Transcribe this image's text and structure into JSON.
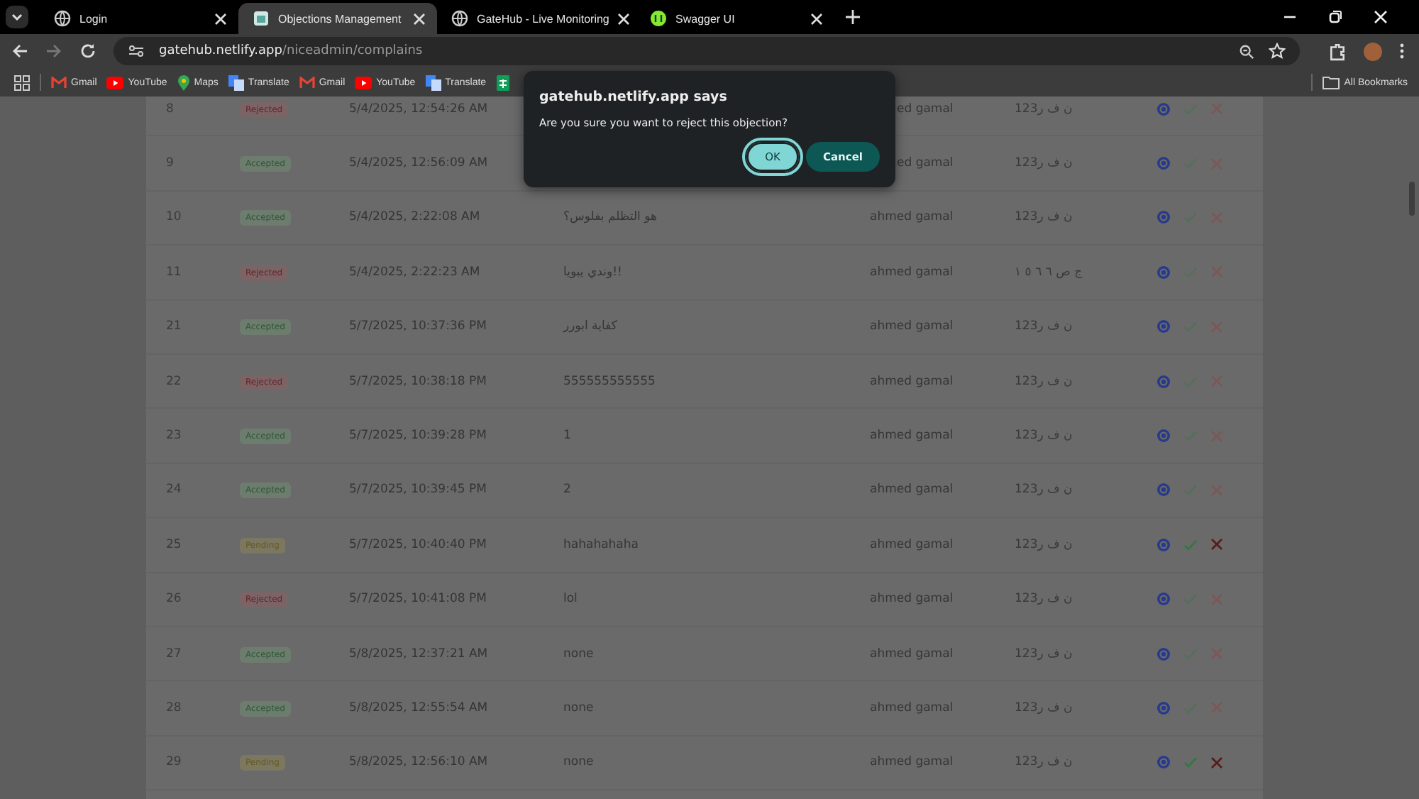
{
  "browser": {
    "tabs": [
      {
        "title": "Login",
        "kind": "globe",
        "selected": false
      },
      {
        "title": "Objections Management",
        "kind": "app",
        "selected": true
      },
      {
        "title": "GateHub - Live Monitoring",
        "kind": "globe",
        "selected": false
      },
      {
        "title": "Swagger UI",
        "kind": "swagger",
        "selected": false
      }
    ],
    "url_host": "gatehub.netlify.app",
    "url_path": "/niceadmin/complains",
    "bookmarks": [
      {
        "label": "Gmail",
        "kind": "gmail"
      },
      {
        "label": "YouTube",
        "kind": "youtube"
      },
      {
        "label": "Maps",
        "kind": "maps"
      },
      {
        "label": "Translate",
        "kind": "translate"
      },
      {
        "label": "Gmail",
        "kind": "gmail"
      },
      {
        "label": "YouTube",
        "kind": "youtube"
      },
      {
        "label": "Translate",
        "kind": "translate"
      },
      {
        "kind": "sheets"
      }
    ],
    "all_bookmarks": "All Bookmarks"
  },
  "table": {
    "rows": [
      {
        "id": "8",
        "status": "Rejected",
        "kind": "rejected",
        "date": "5/4/2025, 12:54:26 AM",
        "user": "ed gamal",
        "plate": "123ن ف ر"
      },
      {
        "id": "9",
        "status": "Accepted",
        "kind": "accepted",
        "date": "5/4/2025, 12:56:09 AM",
        "user": "ed gamal",
        "plate": "123ن ف ر"
      },
      {
        "id": "10",
        "status": "Accepted",
        "kind": "accepted",
        "date": "5/4/2025, 2:22:08 AM",
        "text": "هو التظلم بفلوس؟",
        "user": "ahmed gamal",
        "plate": "123ن ف ر"
      },
      {
        "id": "11",
        "status": "Rejected",
        "kind": "rejected",
        "date": "5/4/2025, 2:22:23 AM",
        "text": "وندي يبويا!!",
        "user": "ahmed gamal",
        "plate": "ج ص ٦ ٦ ٥ ١"
      },
      {
        "id": "21",
        "status": "Accepted",
        "kind": "accepted",
        "date": "5/7/2025, 10:37:36 PM",
        "text": "كفاية ابورر",
        "user": "ahmed gamal",
        "plate": "123ن ف ر"
      },
      {
        "id": "22",
        "status": "Rejected",
        "kind": "rejected",
        "date": "5/7/2025, 10:38:18 PM",
        "text": "555555555555",
        "user": "ahmed gamal",
        "plate": "123ن ف ر"
      },
      {
        "id": "23",
        "status": "Accepted",
        "kind": "accepted",
        "date": "5/7/2025, 10:39:28 PM",
        "text": "1",
        "user": "ahmed gamal",
        "plate": "123ن ف ر"
      },
      {
        "id": "24",
        "status": "Accepted",
        "kind": "accepted",
        "date": "5/7/2025, 10:39:45 PM",
        "text": "2",
        "user": "ahmed gamal",
        "plate": "123ن ف ر"
      },
      {
        "id": "25",
        "status": "Pending",
        "kind": "pending",
        "date": "5/7/2025, 10:40:40 PM",
        "text": "hahahahaha",
        "user": "ahmed gamal",
        "plate": "123ن ف ر"
      },
      {
        "id": "26",
        "status": "Rejected",
        "kind": "rejected",
        "date": "5/7/2025, 10:41:08 PM",
        "text": "lol",
        "user": "ahmed gamal",
        "plate": "123ن ف ر"
      },
      {
        "id": "27",
        "status": "Accepted",
        "kind": "accepted",
        "date": "5/8/2025, 12:37:21 AM",
        "text": "none",
        "user": "ahmed gamal",
        "plate": "123ن ف ر"
      },
      {
        "id": "28",
        "status": "Accepted",
        "kind": "accepted",
        "date": "5/8/2025, 12:55:54 AM",
        "text": "none",
        "user": "ahmed gamal",
        "plate": "123ن ف ر"
      },
      {
        "id": "29",
        "status": "Pending",
        "kind": "pending",
        "date": "5/8/2025, 12:56:10 AM",
        "text": "none",
        "user": "ahmed gamal",
        "plate": "123ن ف ر"
      }
    ]
  },
  "dialog": {
    "title": "gatehub.netlify.app says",
    "message": "Are you sure you want to reject this objection?",
    "ok": "OK",
    "cancel": "Cancel"
  }
}
